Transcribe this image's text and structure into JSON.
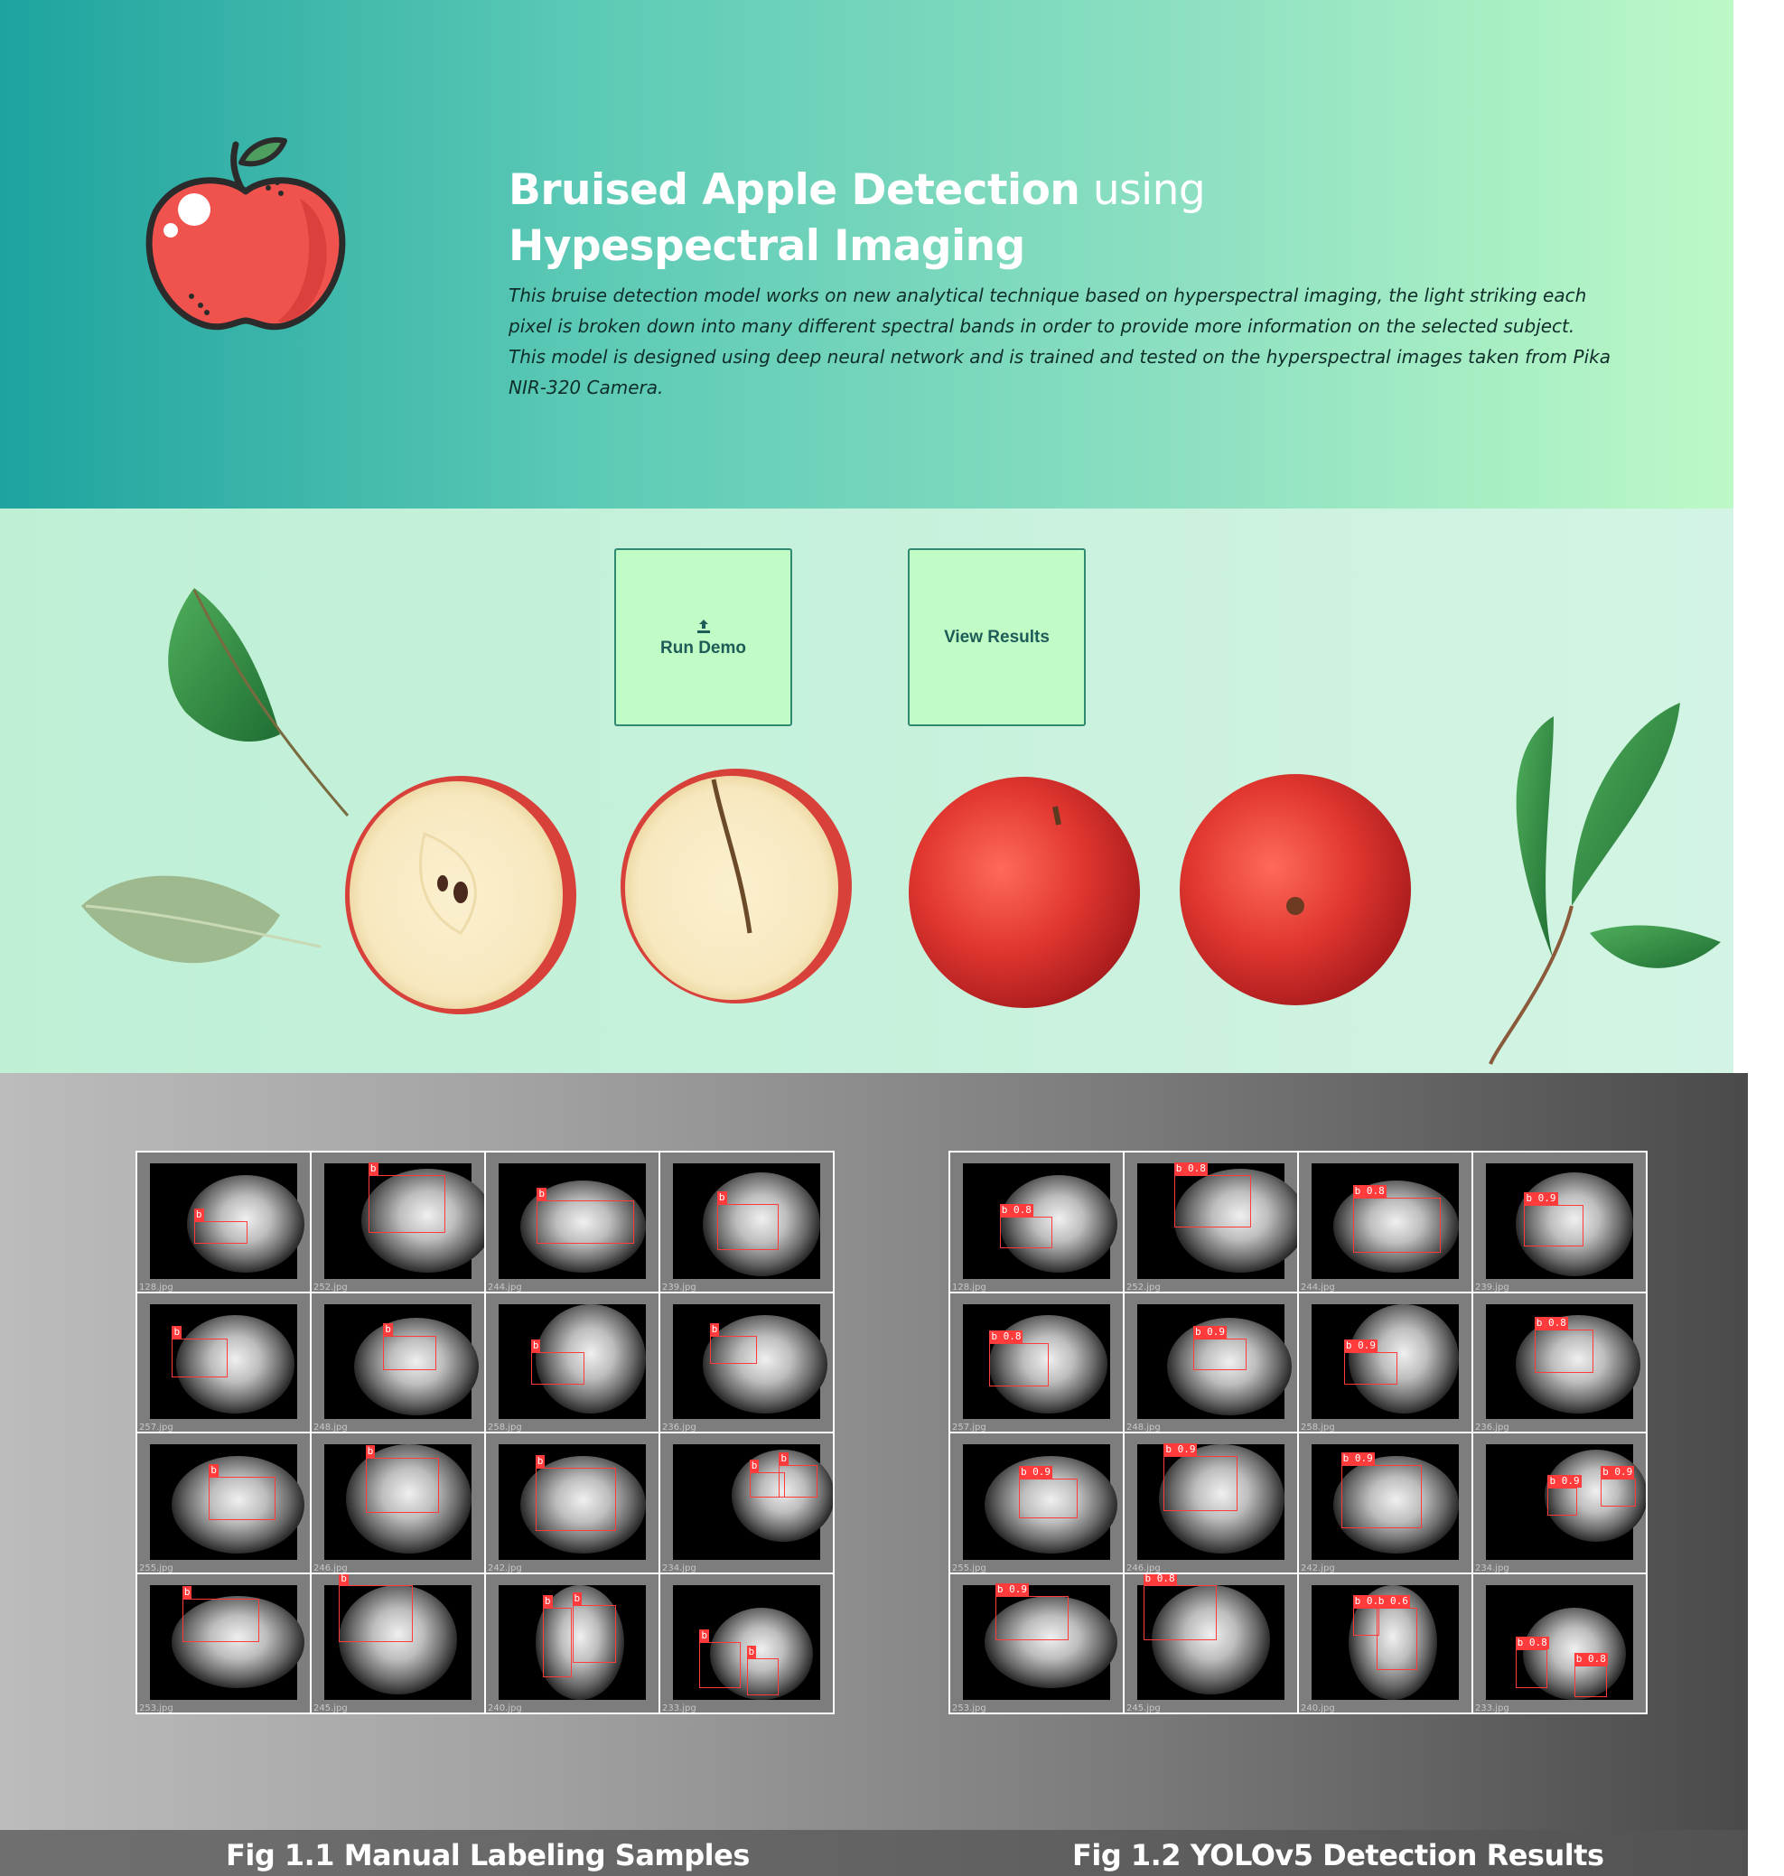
{
  "hero": {
    "title_bold": "Bruised Apple Detection",
    "title_light": " using",
    "title_line2": "Hypespectral Imaging",
    "desc_line1": "This bruise detection model works on new analytical technique based on hyperspectral imaging, the light striking each pixel is broken down into many different spectral bands in order to provide more information on the selected subject.",
    "desc_line2": "This model is designed using deep neural network and is trained and tested on the hyperspectral images taken from Pika NIR-320 Camera."
  },
  "actions": {
    "run_demo": "Run Demo",
    "view_results": "View Results",
    "run_icon": "upload-icon"
  },
  "figures": {
    "left_caption": "Fig 1.1 Manual Labeling Samples",
    "right_caption": "Fig 1.2 YOLOv5 Detection Results",
    "filenames": [
      "128.jpg",
      "252.jpg",
      "244.jpg",
      "239.jpg",
      "257.jpg",
      "248.jpg",
      "258.jpg",
      "236.jpg",
      "255.jpg",
      "246.jpg",
      "242.jpg",
      "234.jpg",
      "253.jpg",
      "245.jpg",
      "240.jpg",
      "233.jpg"
    ],
    "manual_labels": [
      "b",
      "b",
      "b",
      "b",
      "b",
      "b",
      "b",
      "b",
      "b",
      "b",
      "b",
      "b b",
      "b",
      "b",
      "b b",
      "b b"
    ],
    "detections": [
      "b 0.8",
      "b 0.8",
      "b 0.8",
      "b 0.9",
      "b 0.8",
      "b 0.9",
      "b 0.9",
      "b 0.8",
      "b 0.9",
      "b 0.9",
      "b 0.9",
      "b 0.9 b 0.9",
      "b 0.9",
      "b 0.8",
      "b 0.6 b 0.6",
      "b 0.8 b 0.8"
    ]
  },
  "colors": {
    "accent": "#1ea39f",
    "button_bg": "#c1fcc7",
    "box": "#ff3b3b"
  }
}
